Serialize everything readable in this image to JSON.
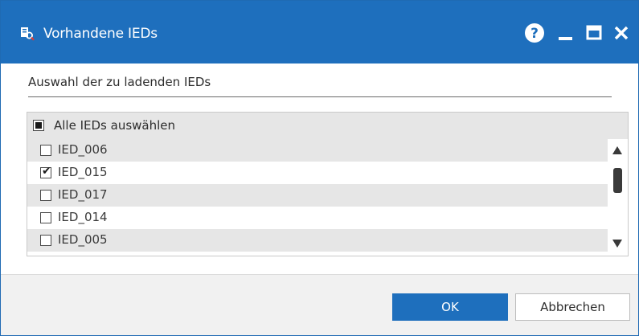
{
  "window": {
    "title": "Vorhandene IEDs",
    "accent_color": "#1e6fbd",
    "icons": {
      "app": "device-search-icon",
      "help": "help-icon",
      "minimize": "minimize-icon",
      "maximize": "maximize-icon",
      "close": "close-icon"
    }
  },
  "section": {
    "title": "Auswahl der zu ladenden IEDs"
  },
  "list": {
    "select_all_label": "Alle IEDs auswählen",
    "select_all_state": "indeterminate",
    "items": [
      {
        "label": "IED_006",
        "checked": false
      },
      {
        "label": "IED_015",
        "checked": true
      },
      {
        "label": "IED_017",
        "checked": false
      },
      {
        "label": "IED_014",
        "checked": false
      },
      {
        "label": "IED_005",
        "checked": false
      }
    ],
    "check_glyph": "✔"
  },
  "buttons": {
    "ok": "OK",
    "cancel": "Abbrechen"
  }
}
